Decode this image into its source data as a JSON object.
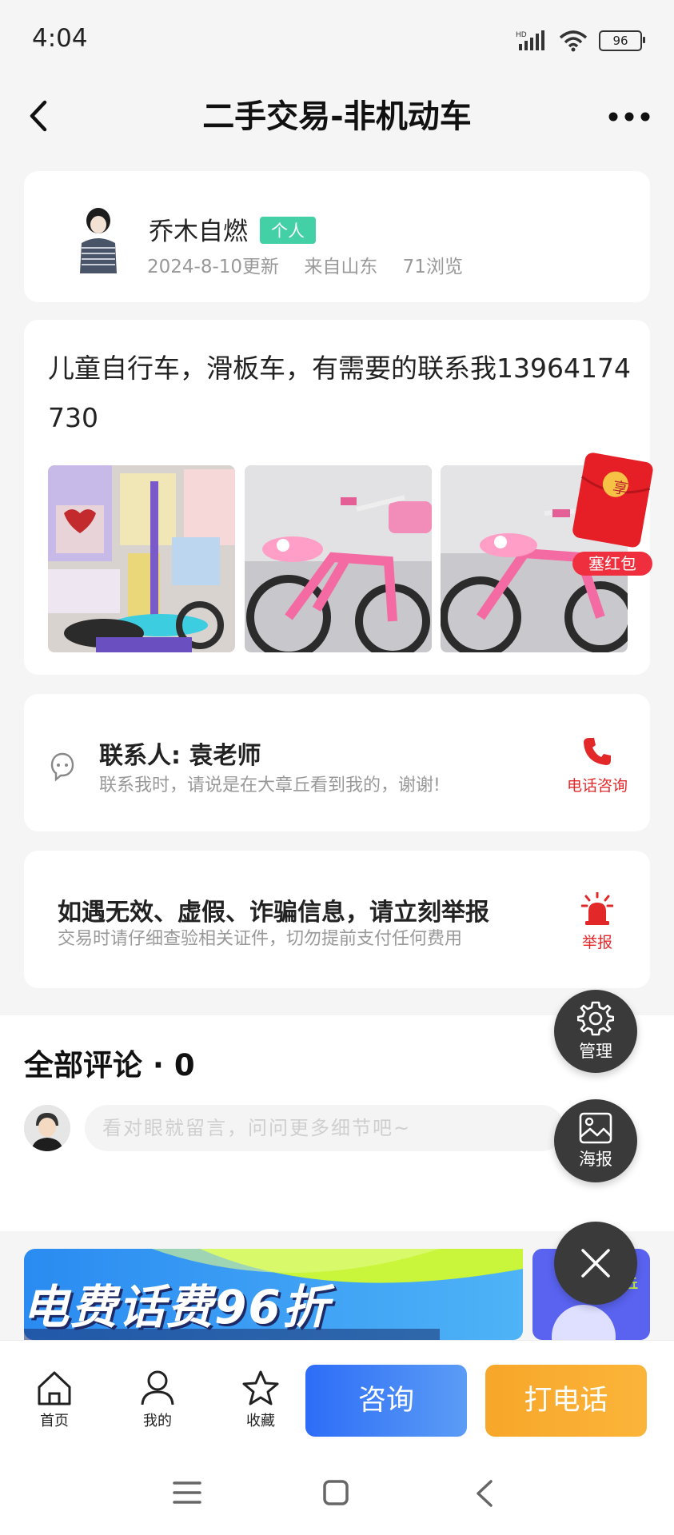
{
  "status": {
    "time": "4:04",
    "battery": "96",
    "network": "HD"
  },
  "header": {
    "title": "二手交易-非机动车"
  },
  "profile": {
    "name": "乔木自燃",
    "tag": "个人",
    "updated": "2024-8-10更新",
    "origin": "来自山东",
    "views": "71浏览"
  },
  "post": {
    "text": "儿童自行车，滑板车，有需要的联系我13964174730",
    "photos": [
      "scooter-photo",
      "pink-bicycle-photo",
      "pink-bicycle-photo-2"
    ],
    "red_packet": {
      "badge": "享",
      "label": "塞红包"
    }
  },
  "contact": {
    "name": "联系人: 袁老师",
    "hint": "联系我时，请说是在大章丘看到我的，谢谢!",
    "phone_label": "电话咨询"
  },
  "report": {
    "title": "如遇无效、虚假、诈骗信息，请立刻举报",
    "subtitle": "交易时请仔细查验相关证件，切勿提前支付任何费用",
    "label": "举报"
  },
  "comments": {
    "title": "全部评论 · 0",
    "placeholder": "看对眼就留言，问问更多细节吧~"
  },
  "banner": {
    "text": "电费话费96折",
    "side_text": "章丘"
  },
  "fabs": {
    "manage": "管理",
    "poster": "海报"
  },
  "bottom_nav": {
    "home": "首页",
    "mine": "我的",
    "favorite": "收藏",
    "consult": "咨询",
    "call": "打电话"
  },
  "colors": {
    "accent_blue": "#2d6df7",
    "accent_orange": "#f7a72a",
    "tag_green": "#44d0a6",
    "alert_red": "#e3282a"
  }
}
